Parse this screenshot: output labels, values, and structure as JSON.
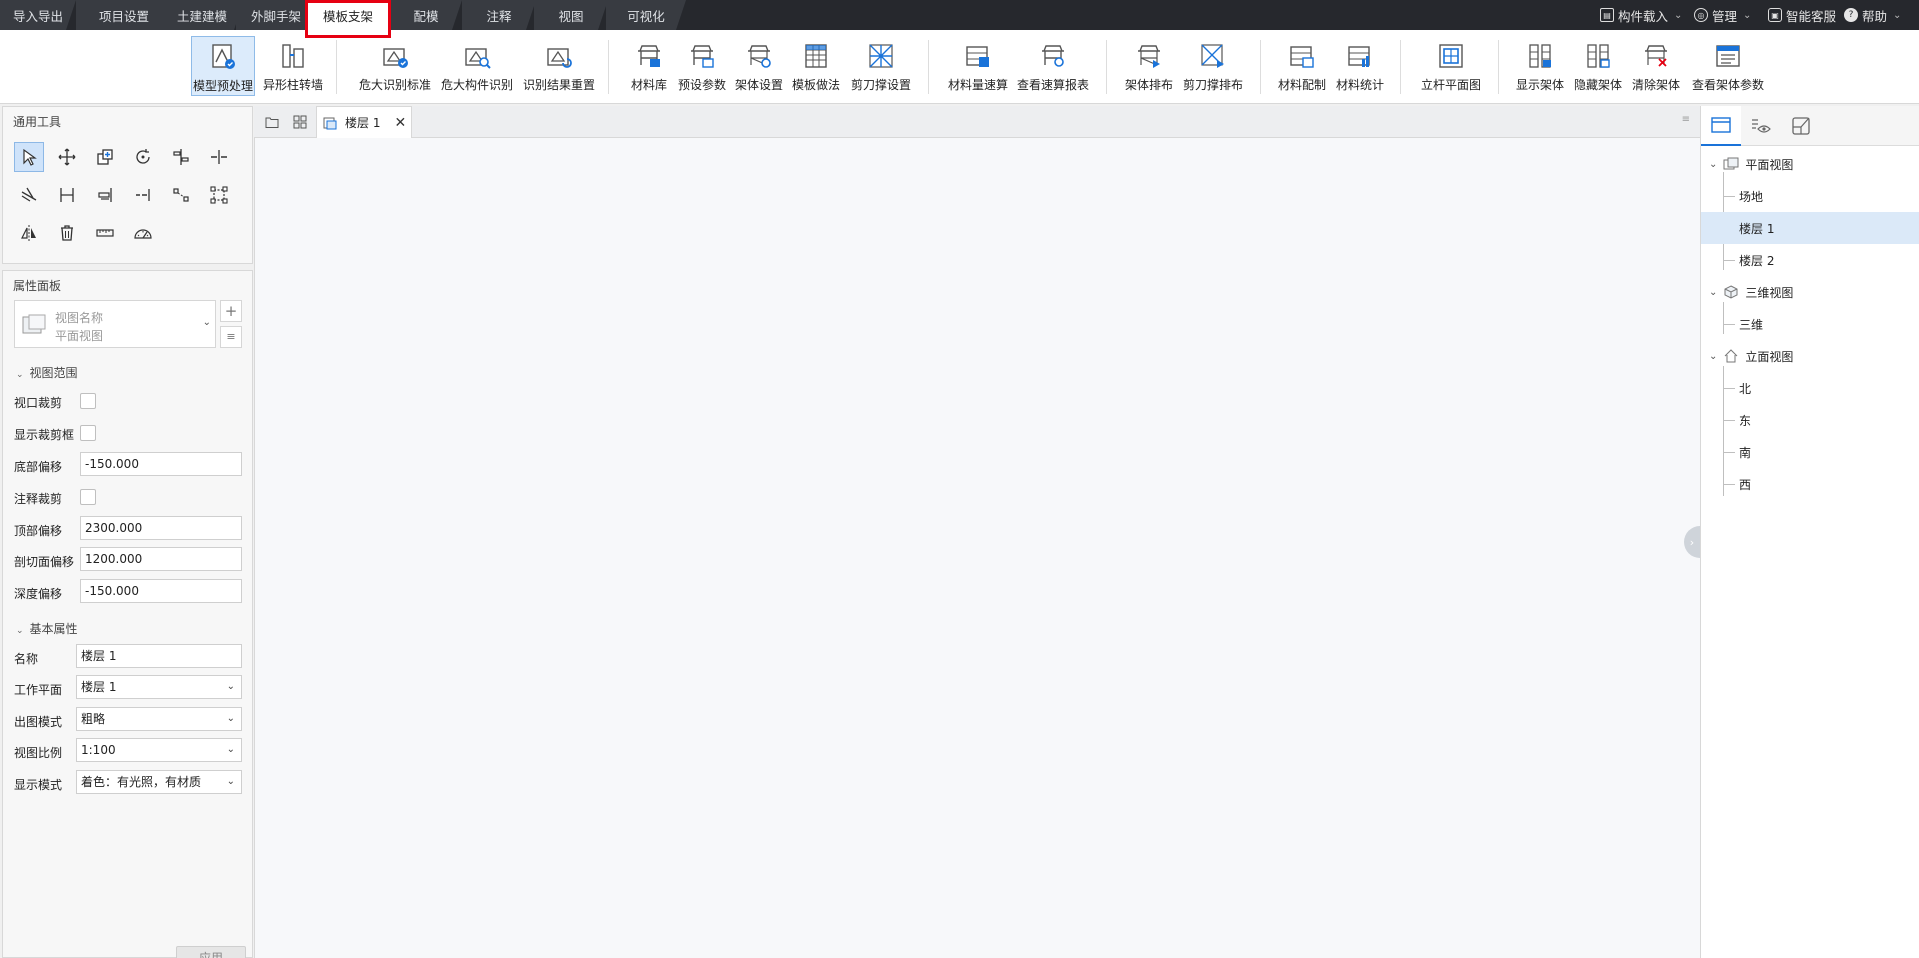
{
  "top_tabs": [
    {
      "label": "导入导出"
    },
    {
      "label": "项目设置"
    },
    {
      "label": "土建建模"
    },
    {
      "label": "外脚手架"
    },
    {
      "label": "模板支架"
    },
    {
      "label": "配模"
    },
    {
      "label": "注释"
    },
    {
      "label": "视图"
    },
    {
      "label": "可视化"
    }
  ],
  "top_right": {
    "component_load": "构件载入",
    "manage": "管理",
    "ai_service": "智能客服",
    "help": "帮助"
  },
  "ribbon": [
    {
      "label": "模型预处理",
      "icon": "model-preprocess-icon",
      "selected": true
    },
    {
      "label": "异形柱转墙",
      "icon": "column-to-wall-icon"
    },
    {
      "label": "危大识别标准",
      "icon": "hazard-standard-icon"
    },
    {
      "label": "危大构件识别",
      "icon": "hazard-identify-icon"
    },
    {
      "label": "识别结果重置",
      "icon": "reset-result-icon"
    },
    {
      "label": "材料库",
      "icon": "material-library-icon"
    },
    {
      "label": "预设参数",
      "icon": "preset-params-icon"
    },
    {
      "label": "架体设置",
      "icon": "frame-settings-icon"
    },
    {
      "label": "模板做法",
      "icon": "formwork-method-icon"
    },
    {
      "label": "剪刀撑设置",
      "icon": "scissor-brace-settings-icon"
    },
    {
      "label": "材料量速算",
      "icon": "material-quick-calc-icon"
    },
    {
      "label": "查看速算报表",
      "icon": "quick-calc-report-icon"
    },
    {
      "label": "架体排布",
      "icon": "frame-layout-icon"
    },
    {
      "label": "剪刀撑排布",
      "icon": "scissor-brace-layout-icon"
    },
    {
      "label": "材料配制",
      "icon": "material-config-icon"
    },
    {
      "label": "材料统计",
      "icon": "material-stats-icon"
    },
    {
      "label": "立杆平面图",
      "icon": "pole-plan-icon"
    },
    {
      "label": "显示架体",
      "icon": "show-frame-icon"
    },
    {
      "label": "隐藏架体",
      "icon": "hide-frame-icon"
    },
    {
      "label": "清除架体",
      "icon": "clear-frame-icon"
    },
    {
      "label": "查看架体参数",
      "icon": "view-frame-params-icon"
    }
  ],
  "tools_panel": {
    "title": "通用工具"
  },
  "properties_panel": {
    "title": "属性面板",
    "view_selector": {
      "line1": "视图名称",
      "line2": "平面视图"
    },
    "section_view_range": "视图范围",
    "section_basic": "基本属性",
    "labels": {
      "viewport_crop": "视口裁剪",
      "show_crop_box": "显示裁剪框",
      "bottom_offset": "底部偏移",
      "annotation_crop": "注释裁剪",
      "top_offset": "顶部偏移",
      "cut_plane_offset": "剖切面偏移",
      "depth_offset": "深度偏移",
      "name": "名称",
      "work_plane": "工作平面",
      "output_mode": "出图模式",
      "view_scale": "视图比例",
      "display_mode": "显示模式"
    },
    "values": {
      "bottom_offset": "-150.000",
      "top_offset": "2300.000",
      "cut_plane_offset": "1200.000",
      "depth_offset": "-150.000",
      "name": "楼层 1",
      "work_plane": "楼层 1",
      "output_mode": "粗略",
      "view_scale": "1:100",
      "display_mode": "着色：有光照，有材质"
    },
    "apply": "应用"
  },
  "doc_tabs": [
    {
      "label": "楼层 1"
    }
  ],
  "tree": {
    "plan": "平面视图",
    "plan_children": [
      "场地",
      "楼层 1",
      "楼层 2"
    ],
    "three_d": "三维视图",
    "three_d_children": [
      "三维"
    ],
    "elevation": "立面视图",
    "elevation_children": [
      "北",
      "东",
      "南",
      "西"
    ],
    "selected": "楼层 1"
  },
  "colors": {
    "accent": "#1a73d9",
    "highlight": "#e60012",
    "selected_bg": "#dbe9f8"
  }
}
